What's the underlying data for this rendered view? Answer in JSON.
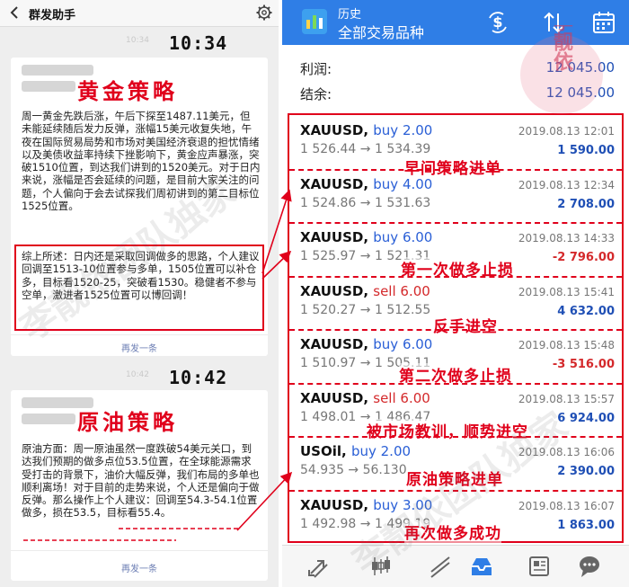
{
  "chat": {
    "title": "群发助手",
    "msg1": {
      "small_time": "10:34",
      "big_time": "10:34",
      "title": "黄金策略",
      "paragraph1": "周一黄金先跌后涨，午后下探至1487.11美元，但未能延续随后发力反弹，涨幅15美元收复失地，午夜在国际贸易局势和市场对美国经济衰退的担忧情绪以及美债收益率持续下挫影响下，黄金应声暴涨，突破1510位置，到达我们讲到的1520美元。对于日内来说，涨幅是否会延续的问题，是目前大家关注的问题，个人偏向于会去试探我们周初讲到的第二目标位1525位置。",
      "paragraph2": "综上所述：日内还是采取回调做多的思路，个人建议回调至1513-10位置参与多单，1505位置可以补仓多，目标看1520-25，突破看1530。稳健者不参与空单，激进者1525位置可以博回调！",
      "repost": "再发一条"
    },
    "msg2": {
      "small_time": "10:42",
      "big_time": "10:42",
      "title": "原油策略",
      "paragraph1": "原油方面：周一原油虽然一度跌破54美元关口，到达我们预期的做多点位53.5位置，在全球能源需求受打击的背景下，油价大幅反弹，我们布局的多单也顺利离场！对于目前的走势来说，个人还是偏向于做反弹。那么操作上个人建议：回调至54.3-54.1位置做多，损在53.5，目标看55.4。",
      "repost": "再发一条"
    }
  },
  "app": {
    "title": "历史",
    "subtitle": "全部交易品种",
    "profit_label": "利润:",
    "profit_value": "12 045.00",
    "balance_label": "结余:",
    "balance_value": "12 045.00",
    "trades": [
      {
        "symbol": "XAUUSD,",
        "side": "buy 2.00",
        "side_type": "buy",
        "date": "2019.08.13 12:01",
        "prices": "1 526.44 → 1 534.39",
        "profit": "1 590.00",
        "positive": true,
        "note": "早间策略进单"
      },
      {
        "symbol": "XAUUSD,",
        "side": "buy 4.00",
        "side_type": "buy",
        "date": "2019.08.13 12:34",
        "prices": "1 524.86 → 1 531.63",
        "profit": "2 708.00",
        "positive": true,
        "note": ""
      },
      {
        "symbol": "XAUUSD,",
        "side": "buy 6.00",
        "side_type": "buy",
        "date": "2019.08.13 14:33",
        "prices": "1 525.97 → 1 521.31",
        "profit": "-2 796.00",
        "positive": false,
        "note": "第一次做多止损"
      },
      {
        "symbol": "XAUUSD,",
        "side": "sell 6.00",
        "side_type": "sell",
        "date": "2019.08.13 15:41",
        "prices": "1 520.27 → 1 512.55",
        "profit": "4 632.00",
        "positive": true,
        "note": "反手进空"
      },
      {
        "symbol": "XAUUSD,",
        "side": "buy 6.00",
        "side_type": "buy",
        "date": "2019.08.13 15:48",
        "prices": "1 510.97 → 1 505.11",
        "profit": "-3 516.00",
        "positive": false,
        "note": "第二次做多止损"
      },
      {
        "symbol": "XAUUSD,",
        "side": "sell 6.00",
        "side_type": "sell",
        "date": "2019.08.13 15:57",
        "prices": "1 498.01 → 1 486.47",
        "profit": "6 924.00",
        "positive": true,
        "note": "被市场教训，顺势进空"
      },
      {
        "symbol": "USOil,",
        "side": "buy 2.00",
        "side_type": "buy",
        "date": "2019.08.13 16:06",
        "prices": "54.935 → 56.130",
        "profit": "2 390.00",
        "positive": true,
        "note": "原油策略进单"
      },
      {
        "symbol": "XAUUSD,",
        "side": "buy 3.00",
        "side_type": "buy",
        "date": "2019.08.13 16:07",
        "prices": "1 492.98 → 1 499.19",
        "profit": "1 863.00",
        "positive": true,
        "note": "再次做多成功"
      }
    ]
  },
  "overlay": {
    "watermark_text": "李靓依团队独家",
    "watermark_text2": "李靓依团队独家",
    "seal_text": "李靓依"
  },
  "colors": {
    "accent_red": "#e0001b",
    "app_bar": "#2f7ee6",
    "buy_blue": "#2a5fd6",
    "sell_red": "#d4292b",
    "profit_pos": "#1f4fb5",
    "profit_neg": "#d4292b"
  },
  "icons": {
    "back": "back-arrow-icon",
    "settings": "gear-icon",
    "currency": "currency-exchange-icon",
    "sort": "sort-icon",
    "calendar": "calendar-icon",
    "tabs": [
      "quotes-arrows-icon",
      "chart-candles-icon",
      "trade-lines-icon",
      "history-inbox-icon",
      "news-icon",
      "messages-icon"
    ]
  }
}
